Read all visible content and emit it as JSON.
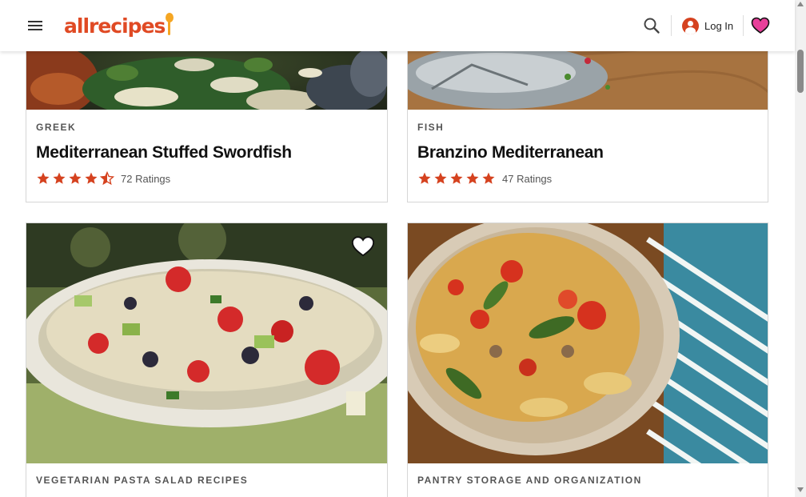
{
  "header": {
    "logo_text": "allrecipes",
    "login_label": "Log In",
    "brand_color": "#e04a24",
    "accent_color": "#f5a623"
  },
  "cards": [
    {
      "tag": "GREEK",
      "title": "Mediterranean Stuffed Swordfish",
      "rating_value": 4.5,
      "ratings_label": "72 Ratings"
    },
    {
      "tag": "FISH",
      "title": "Branzino Mediterranean",
      "rating_value": 5,
      "ratings_label": "47 Ratings"
    },
    {
      "tag": "VEGETARIAN PASTA SALAD RECIPES"
    },
    {
      "tag": "PANTRY STORAGE AND ORGANIZATION"
    }
  ],
  "icons": {
    "menu": "hamburger-icon",
    "search": "search-icon",
    "account": "account-icon",
    "favorites": "heart-icon",
    "save": "heart-outline-icon",
    "star": "star-icon"
  },
  "star_color": "#d5421f"
}
